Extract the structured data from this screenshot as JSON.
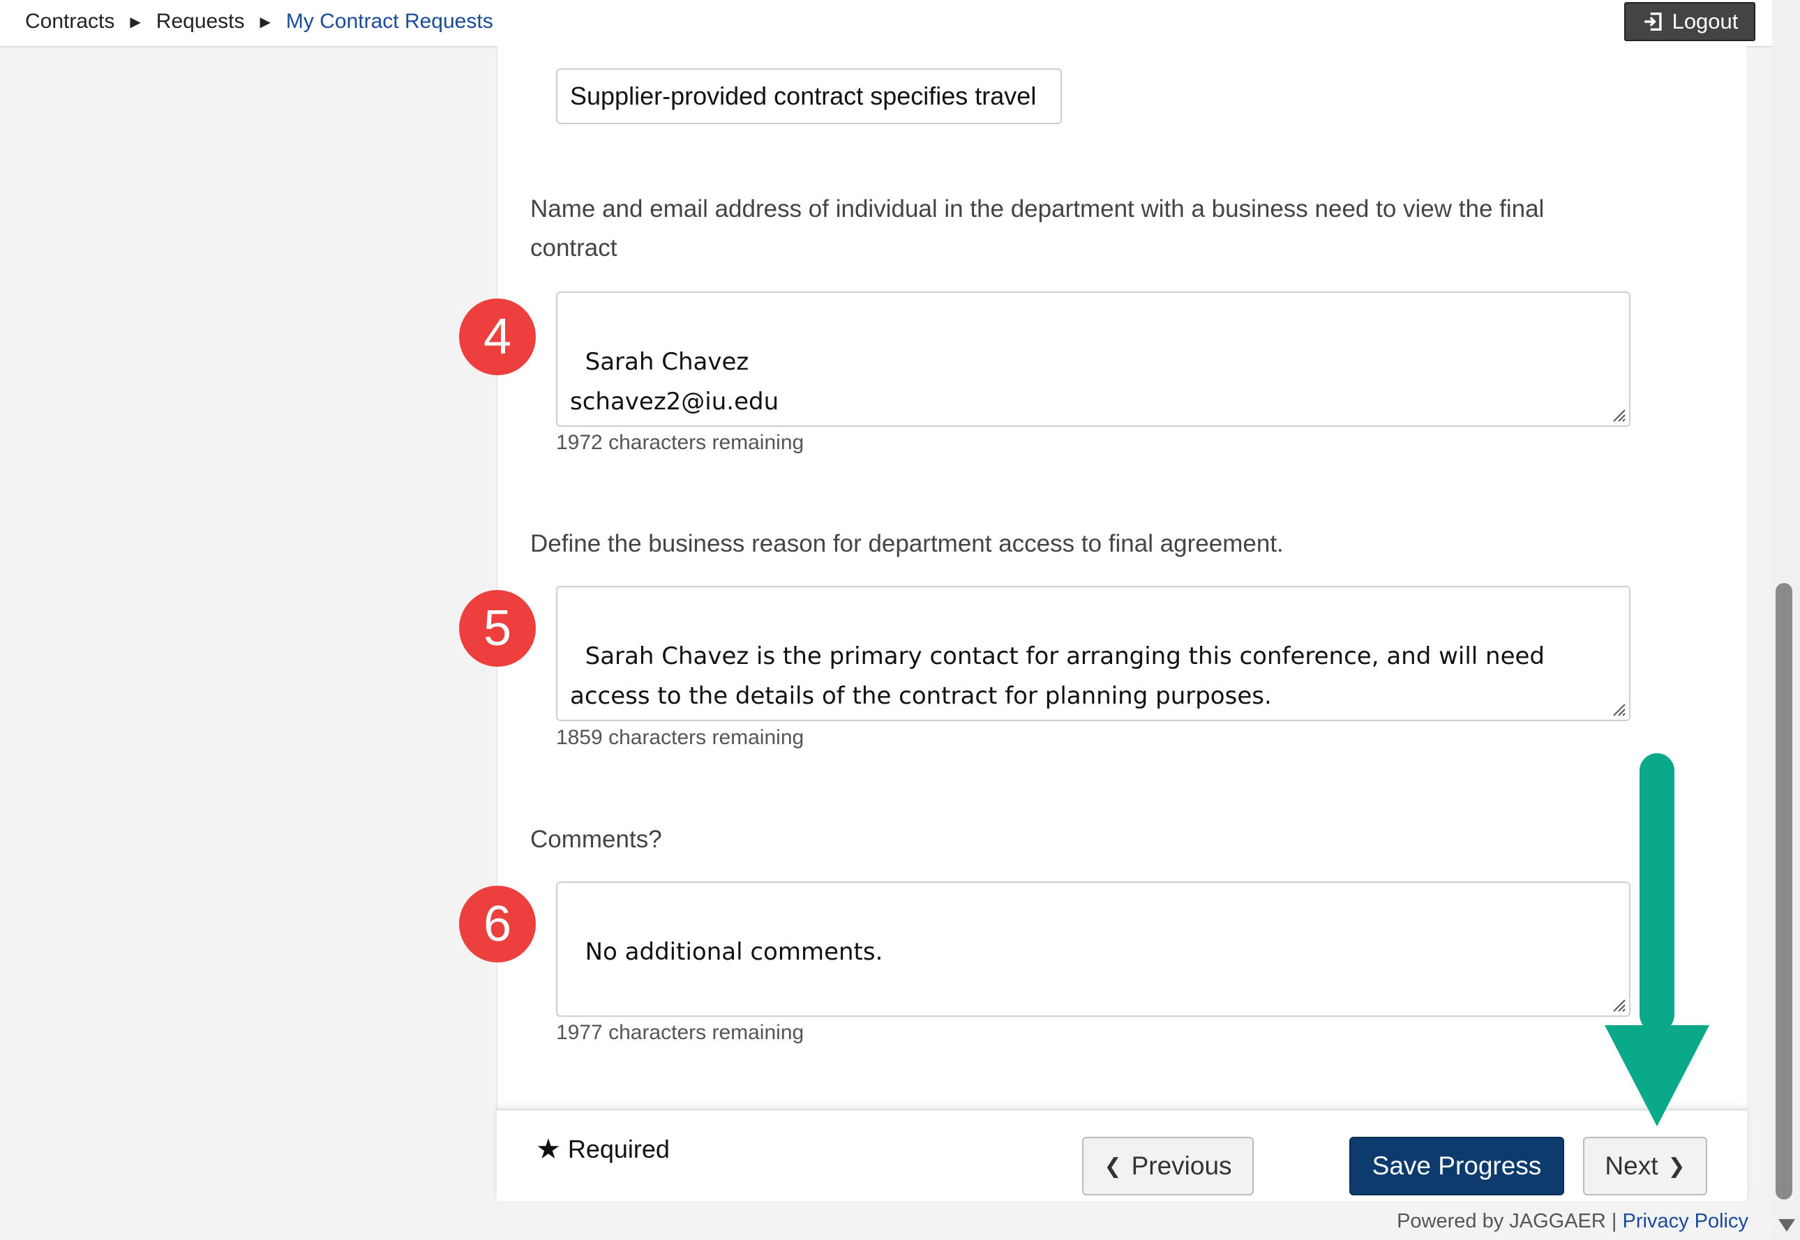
{
  "breadcrumb": {
    "items": [
      "Contracts",
      "Requests",
      "My Contract Requests"
    ]
  },
  "header": {
    "logout_label": "Logout"
  },
  "form": {
    "travel_option": "Supplier-provided contract specifies travel",
    "questions": [
      {
        "step": "4",
        "label": "Name and email address of individual in the department with a business need to view the final contract",
        "value": "Sarah Chavez\nschavez2@iu.edu",
        "remaining": "1972 characters remaining"
      },
      {
        "step": "5",
        "label": "Define the business reason for department access to final agreement.",
        "value": "Sarah Chavez is the primary contact for arranging this conference, and will need access to the details of the contract for planning purposes.",
        "remaining": "1859 characters remaining"
      },
      {
        "step": "6",
        "label": "Comments?",
        "value": "No additional comments.",
        "remaining": "1977 characters remaining"
      }
    ]
  },
  "footer": {
    "required_label": "Required",
    "previous_label": "Previous",
    "save_label": "Save Progress",
    "next_label": "Next"
  },
  "powered_by": {
    "text": "Powered by JAGGAER |",
    "privacy_link": "Privacy Policy"
  },
  "colors": {
    "step_badge": "#ee3f3f",
    "primary_button": "#0d3b6e",
    "annotation_arrow": "#0aa98a",
    "link": "#1a4b9a"
  },
  "icons": [
    "caret-right-icon",
    "logout-icon",
    "star-icon",
    "chevron-left-icon",
    "chevron-right-icon",
    "resize-grip-icon",
    "down-arrow-annotation"
  ]
}
